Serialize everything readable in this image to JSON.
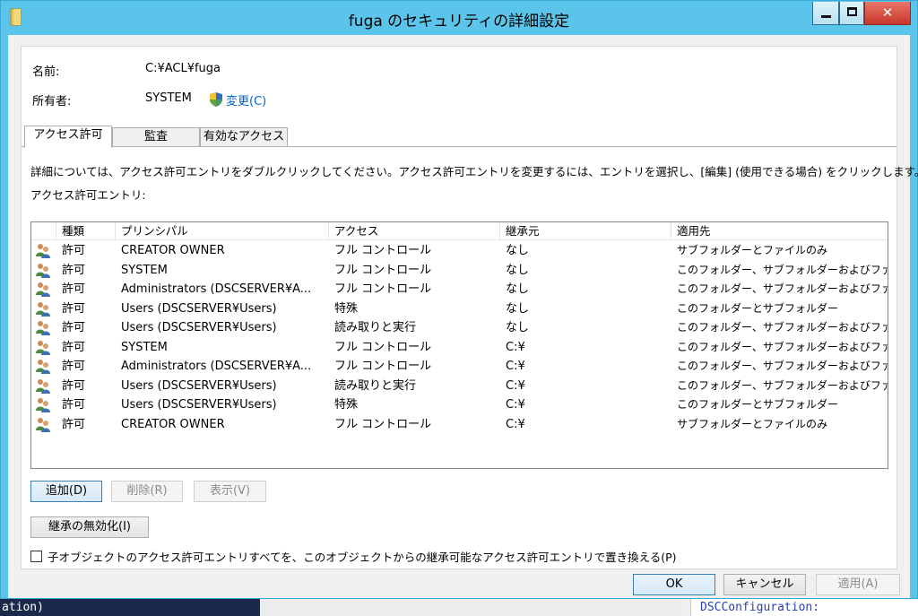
{
  "window": {
    "title": "fuga のセキュリティの詳細設定"
  },
  "info": {
    "name_label": "名前:",
    "name_value": "C:¥ACL¥fuga",
    "owner_label": "所有者:",
    "owner_value": "SYSTEM",
    "change_link": "変更(C)"
  },
  "tabs": [
    {
      "label": "アクセス許可",
      "active": true
    },
    {
      "label": "監査",
      "active": false
    },
    {
      "label": "有効なアクセス",
      "active": false
    }
  ],
  "description": "詳細については、アクセス許可エントリをダブルクリックしてください。アクセス許可エントリを変更するには、エントリを選択し、[編集] (使用できる場合) をクリックします。",
  "list_label": "アクセス許可エントリ:",
  "columns": [
    "種類",
    "プリンシパル",
    "アクセス",
    "継承元",
    "適用先"
  ],
  "entries": [
    {
      "type": "許可",
      "principal": "CREATOR OWNER",
      "access": "フル コントロール",
      "inherited": "なし",
      "applies": "サブフォルダーとファイルのみ"
    },
    {
      "type": "許可",
      "principal": "SYSTEM",
      "access": "フル コントロール",
      "inherited": "なし",
      "applies": "このフォルダー、サブフォルダーおよびファイル"
    },
    {
      "type": "許可",
      "principal": "Administrators (DSCSERVER¥A...",
      "access": "フル コントロール",
      "inherited": "なし",
      "applies": "このフォルダー、サブフォルダーおよびファイル"
    },
    {
      "type": "許可",
      "principal": "Users (DSCSERVER¥Users)",
      "access": "特殊",
      "inherited": "なし",
      "applies": "このフォルダーとサブフォルダー"
    },
    {
      "type": "許可",
      "principal": "Users (DSCSERVER¥Users)",
      "access": "読み取りと実行",
      "inherited": "なし",
      "applies": "このフォルダー、サブフォルダーおよびファイル"
    },
    {
      "type": "許可",
      "principal": "SYSTEM",
      "access": "フル コントロール",
      "inherited": "C:¥",
      "applies": "このフォルダー、サブフォルダーおよびファイル"
    },
    {
      "type": "許可",
      "principal": "Administrators (DSCSERVER¥A...",
      "access": "フル コントロール",
      "inherited": "C:¥",
      "applies": "このフォルダー、サブフォルダーおよびファイル"
    },
    {
      "type": "許可",
      "principal": "Users (DSCSERVER¥Users)",
      "access": "読み取りと実行",
      "inherited": "C:¥",
      "applies": "このフォルダー、サブフォルダーおよびファイル"
    },
    {
      "type": "許可",
      "principal": "Users (DSCSERVER¥Users)",
      "access": "特殊",
      "inherited": "C:¥",
      "applies": "このフォルダーとサブフォルダー"
    },
    {
      "type": "許可",
      "principal": "CREATOR OWNER",
      "access": "フル コントロール",
      "inherited": "C:¥",
      "applies": "サブフォルダーとファイルのみ"
    }
  ],
  "buttons": {
    "add": "追加(D)",
    "remove": "削除(R)",
    "view": "表示(V)",
    "disable_inheritance": "継承の無効化(I)",
    "ok": "OK",
    "cancel": "キャンセル",
    "apply": "適用(A)"
  },
  "replace_checkbox": {
    "label": "子オブジェクトのアクセス許可エントリすべてを、このオブジェクトからの継承可能なアクセス許可エントリで置き換える(P)",
    "checked": false
  },
  "background": {
    "left_text": "ation)",
    "right_text": "DSCConfiguration:"
  }
}
